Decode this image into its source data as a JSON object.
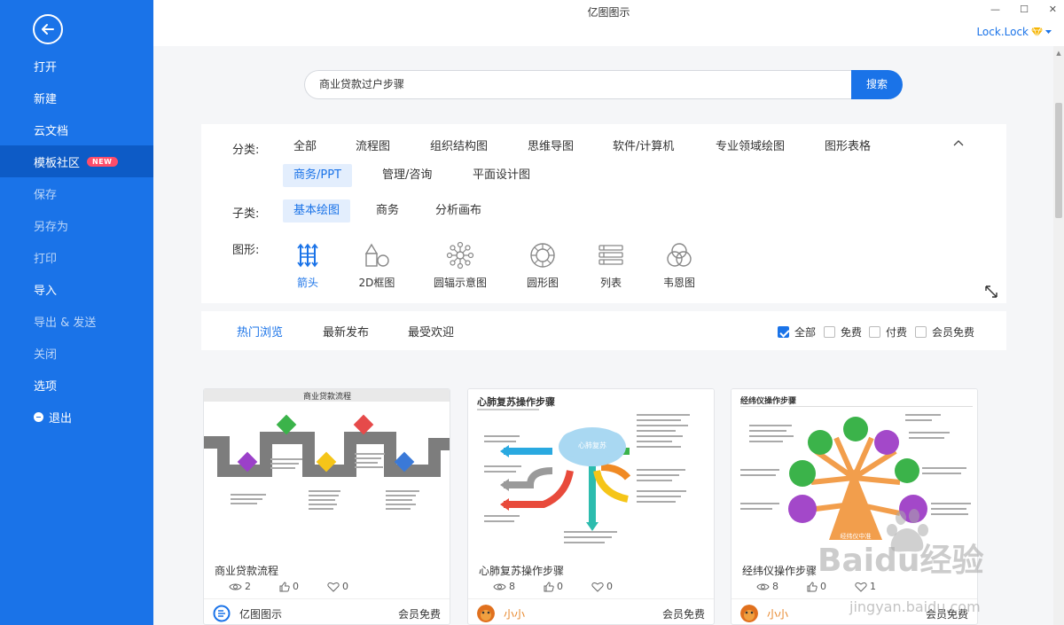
{
  "window": {
    "title": "亿图图示",
    "user": "Lock.Lock",
    "controls": [
      "—",
      "☐",
      "✕"
    ]
  },
  "sidebar": {
    "items": [
      {
        "label": "打开",
        "state": "normal"
      },
      {
        "label": "新建",
        "state": "normal"
      },
      {
        "label": "云文档",
        "state": "normal"
      },
      {
        "label": "模板社区",
        "state": "active",
        "badge": "NEW"
      },
      {
        "label": "保存",
        "state": "dim"
      },
      {
        "label": "另存为",
        "state": "dim"
      },
      {
        "label": "打印",
        "state": "dim"
      },
      {
        "label": "导入",
        "state": "normal"
      },
      {
        "label": "导出 & 发送",
        "state": "dim"
      },
      {
        "label": "关闭",
        "state": "dim"
      },
      {
        "label": "选项",
        "state": "normal"
      },
      {
        "label": "退出",
        "state": "normal"
      }
    ]
  },
  "search": {
    "value": "商业贷款过户步骤",
    "button": "搜索"
  },
  "filters": {
    "category_label": "分类:",
    "categories": [
      "全部",
      "流程图",
      "组织结构图",
      "思维导图",
      "软件/计算机",
      "专业领域绘图",
      "图形表格",
      "商务/PPT",
      "管理/咨询",
      "平面设计图"
    ],
    "selected_category": "商务/PPT",
    "subcategory_label": "子类:",
    "subcategories": [
      "基本绘图",
      "商务",
      "分析画布"
    ],
    "selected_subcategory": "基本绘图",
    "shape_label": "图形:",
    "shapes": [
      {
        "label": "箭头",
        "icon": "arrows-icon"
      },
      {
        "label": "2D框图",
        "icon": "2d-shapes-icon"
      },
      {
        "label": "圆辐示意图",
        "icon": "radial-icon"
      },
      {
        "label": "圆形图",
        "icon": "circle-diagram-icon"
      },
      {
        "label": "列表",
        "icon": "list-icon"
      },
      {
        "label": "韦恩图",
        "icon": "venn-icon"
      }
    ],
    "selected_shape": "箭头"
  },
  "sort": {
    "tabs": [
      "热门浏览",
      "最新发布",
      "最受欢迎"
    ],
    "selected": "热门浏览",
    "price_filters": [
      {
        "label": "全部",
        "checked": true
      },
      {
        "label": "免费",
        "checked": false
      },
      {
        "label": "付费",
        "checked": false
      },
      {
        "label": "会员免费",
        "checked": false
      }
    ]
  },
  "cards": [
    {
      "title": "商业贷款流程",
      "thumb_title": "商业贷款流程",
      "views": "2",
      "likes": "0",
      "favorites": "0",
      "author": "亿图图示",
      "price": "会员免费"
    },
    {
      "title": "心肺复苏操作步骤",
      "thumb_title": "心肺复苏操作步骤",
      "thumb_sub": "心肺复苏",
      "views": "8",
      "likes": "0",
      "favorites": "0",
      "author": "小小",
      "price": "会员免费"
    },
    {
      "title": "经纬仪操作步骤",
      "thumb_title": "经纬仪操作步骤",
      "thumb_center": "经纬仪中准",
      "views": "8",
      "likes": "0",
      "favorites": "1",
      "author": "小小",
      "price": "会员免费"
    }
  ],
  "watermark": {
    "line1": "Baidu经验",
    "line2": "jingyan.baidu.com"
  },
  "colors": {
    "accent": "#1a73e8",
    "sidebar": "#1a73e8",
    "badge": "#ff4d6a"
  }
}
